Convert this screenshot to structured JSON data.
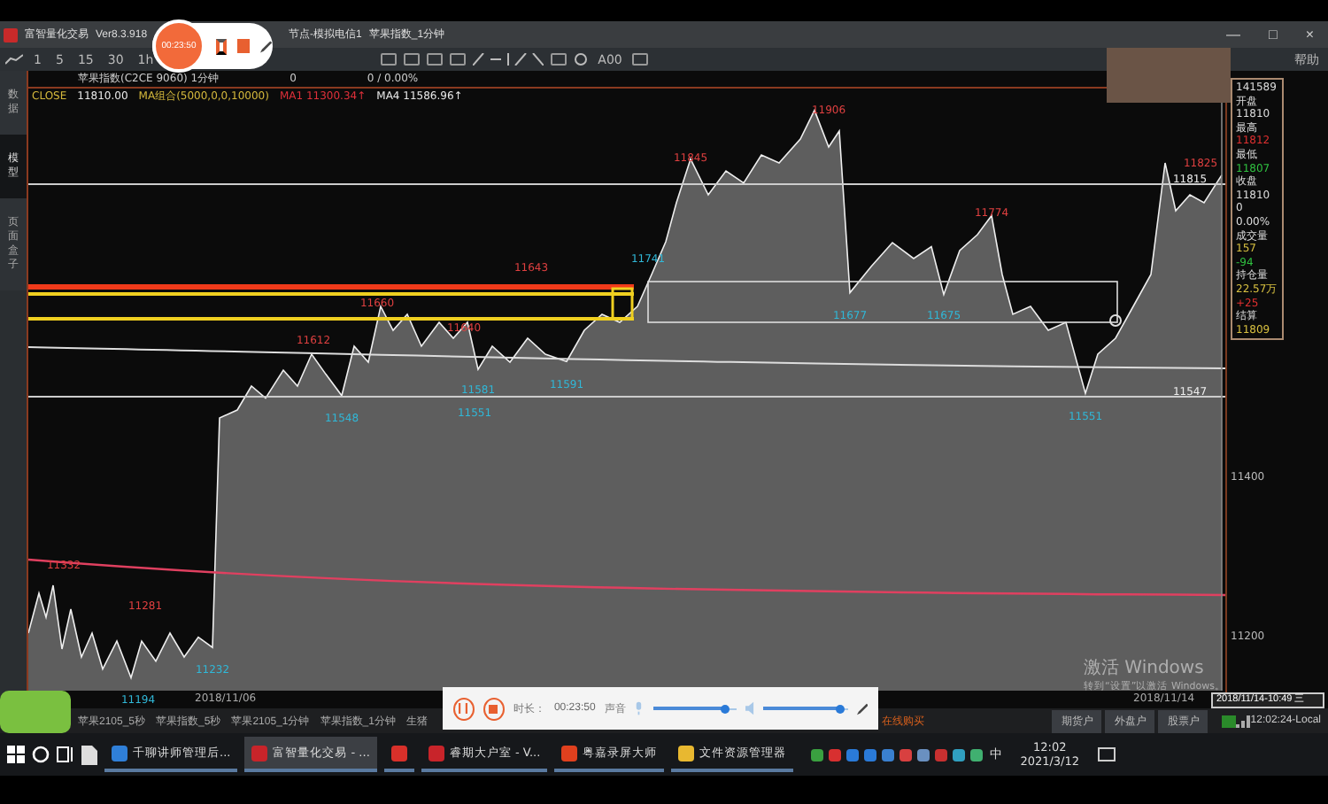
{
  "recorder_badge": {
    "time": "00:23:50"
  },
  "window": {
    "app": "富智量化交易",
    "version": "Ver8.3.918",
    "node": "节点-模拟电信1",
    "symbol": "苹果指数_1分钟",
    "controls": [
      "—",
      "□",
      "×"
    ]
  },
  "toolbar": {
    "periods": [
      "1",
      "5",
      "15",
      "30",
      "1h"
    ],
    "text_tool": "A00",
    "menu": [
      "帮助"
    ]
  },
  "side_tabs": [
    {
      "label": "数据",
      "selected": false
    },
    {
      "label": "模型",
      "selected": true
    },
    {
      "label": "页面盒子",
      "selected": false
    }
  ],
  "info": {
    "symbol": "苹果指数(C2CE 9060) 1分钟",
    "change": "0",
    "change_pct": "0 / 0.00%"
  },
  "indicators": [
    {
      "text": "CLOSE",
      "color": "#d4b83c"
    },
    {
      "text": "11810.00",
      "color": "#e8e8e8"
    },
    {
      "text": "MA组合(5000,0,0,10000)",
      "color": "#d4b83c"
    },
    {
      "text": "MA1 11300.34↑",
      "color": "#e0303a"
    },
    {
      "text": "MA4 11586.96↑",
      "color": "#e8e8e8"
    }
  ],
  "chart": {
    "labels": [
      {
        "text": "11906",
        "kind": "high"
      },
      {
        "text": "11845",
        "kind": "high"
      },
      {
        "text": "11741",
        "kind": "low"
      },
      {
        "text": "11774",
        "kind": "high"
      },
      {
        "text": "11677",
        "kind": "low"
      },
      {
        "text": "11675",
        "kind": "low"
      },
      {
        "text": "11825",
        "kind": "high"
      },
      {
        "text": "11660",
        "kind": "high"
      },
      {
        "text": "11612",
        "kind": "high"
      },
      {
        "text": "11640",
        "kind": "high"
      },
      {
        "text": "11643",
        "kind": "high"
      },
      {
        "text": "11548",
        "kind": "low"
      },
      {
        "text": "11581",
        "kind": "low"
      },
      {
        "text": "11591",
        "kind": "low"
      },
      {
        "text": "11551",
        "kind": "low"
      },
      {
        "text": "11551",
        "kind": "low"
      },
      {
        "text": "11332",
        "kind": "high"
      },
      {
        "text": "11281",
        "kind": "high"
      },
      {
        "text": "11232",
        "kind": "low"
      },
      {
        "text": "11194",
        "kind": "low"
      }
    ],
    "line_marks": [
      "11815",
      "11547"
    ],
    "dates": [
      "2018/11/06",
      "2018/11/14"
    ]
  },
  "axis_ticks": [
    "11400",
    "11200"
  ],
  "cursor_time": "2018/11/14-10:49 三",
  "quote_panel": [
    {
      "text": "141589",
      "kind": "value"
    },
    {
      "text": "开盘",
      "kind": "label"
    },
    {
      "text": "11810",
      "kind": "value"
    },
    {
      "text": "最高",
      "kind": "label"
    },
    {
      "text": "11812",
      "kind": "up"
    },
    {
      "text": "最低",
      "kind": "label"
    },
    {
      "text": "11807",
      "kind": "down"
    },
    {
      "text": "收盘",
      "kind": "label"
    },
    {
      "text": "11810",
      "kind": "value"
    },
    {
      "text": "0",
      "kind": "value"
    },
    {
      "text": "0.00%",
      "kind": "value"
    },
    {
      "text": "成交量",
      "kind": "label"
    },
    {
      "text": "157",
      "kind": "settle"
    },
    {
      "text": "-94",
      "kind": "down"
    },
    {
      "text": "持仓量",
      "kind": "label"
    },
    {
      "text": "22.57万",
      "kind": "settle"
    },
    {
      "text": "+25",
      "kind": "up"
    },
    {
      "text": "结算",
      "kind": "label"
    },
    {
      "text": "11809",
      "kind": "settle"
    }
  ],
  "activation": {
    "title": "激活 Windows",
    "hint": "转到“设置”以激活 Windows。"
  },
  "bottom_tabs": [
    "苹果2105_5秒",
    "苹果指数_5秒",
    "苹果2105_1分钟",
    "苹果指数_1分钟",
    "生猪"
  ],
  "notice": "在线购买",
  "account_buttons": [
    "期货户",
    "外盘户",
    "股票户"
  ],
  "clock": "12:02:24-Local",
  "recorder": {
    "duration_label": "时长：",
    "duration": "00:23:50",
    "sound_label": "声音",
    "mic": {
      "level": 0.85
    },
    "speaker": {
      "level": 0.9
    }
  },
  "taskbar": {
    "apps": [
      {
        "label": "千聊讲师管理后...",
        "color": "#2f7fd8",
        "selected": false
      },
      {
        "label": "富智量化交易 - ...",
        "color": "#c8242a",
        "selected": true
      },
      {
        "color": "#d8302a",
        "selected": false
      },
      {
        "label": "睿期大户室 - V...",
        "color": "#c8242a",
        "selected": false
      },
      {
        "label": "粤嘉录屏大师",
        "color": "#e0401e",
        "selected": false
      },
      {
        "label": "文件资源管理器",
        "color": "#e8b830",
        "selected": false
      }
    ],
    "ime": "中",
    "time": "12:02",
    "date": "2021/3/12"
  }
}
